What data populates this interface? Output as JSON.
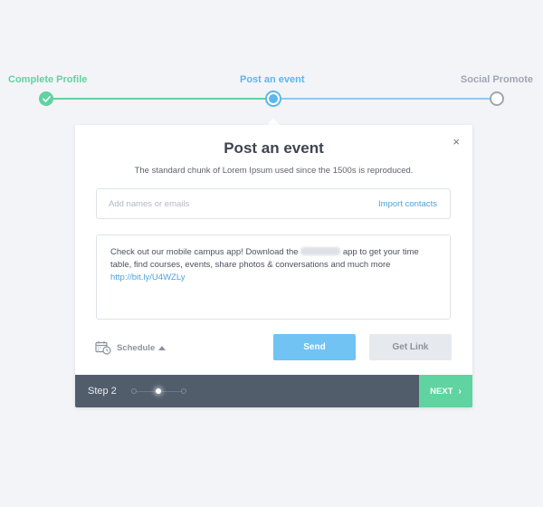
{
  "stepper": {
    "steps": [
      {
        "label": "Complete Profile",
        "state": "done"
      },
      {
        "label": "Post an event",
        "state": "active"
      },
      {
        "label": "Social Promote",
        "state": "todo"
      }
    ]
  },
  "modal": {
    "title": "Post an event",
    "subtitle": "The standard chunk of Lorem Ipsum used since the 1500s is reproduced.",
    "close_icon": "×",
    "recipient": {
      "placeholder": "Add names or emails",
      "value": ""
    },
    "import_label": "Import contacts",
    "message": {
      "before": "Check out our mobile campus app! Download the ",
      "after": " app to get your time table, find courses, events, share photos & conversations and much more",
      "link": "http://bit.ly/U4WZLy"
    },
    "schedule_label": "Schedule",
    "send_label": "Send",
    "getlink_label": "Get Link"
  },
  "footer": {
    "step_label": "Step 2",
    "total_dots": 3,
    "active_dot": 2,
    "next_label": "NEXT",
    "next_icon": "›"
  },
  "colors": {
    "green": "#5fd3a0",
    "blue": "#5cb7ec",
    "footer": "#525d6c",
    "background": "#f3f4f8"
  }
}
